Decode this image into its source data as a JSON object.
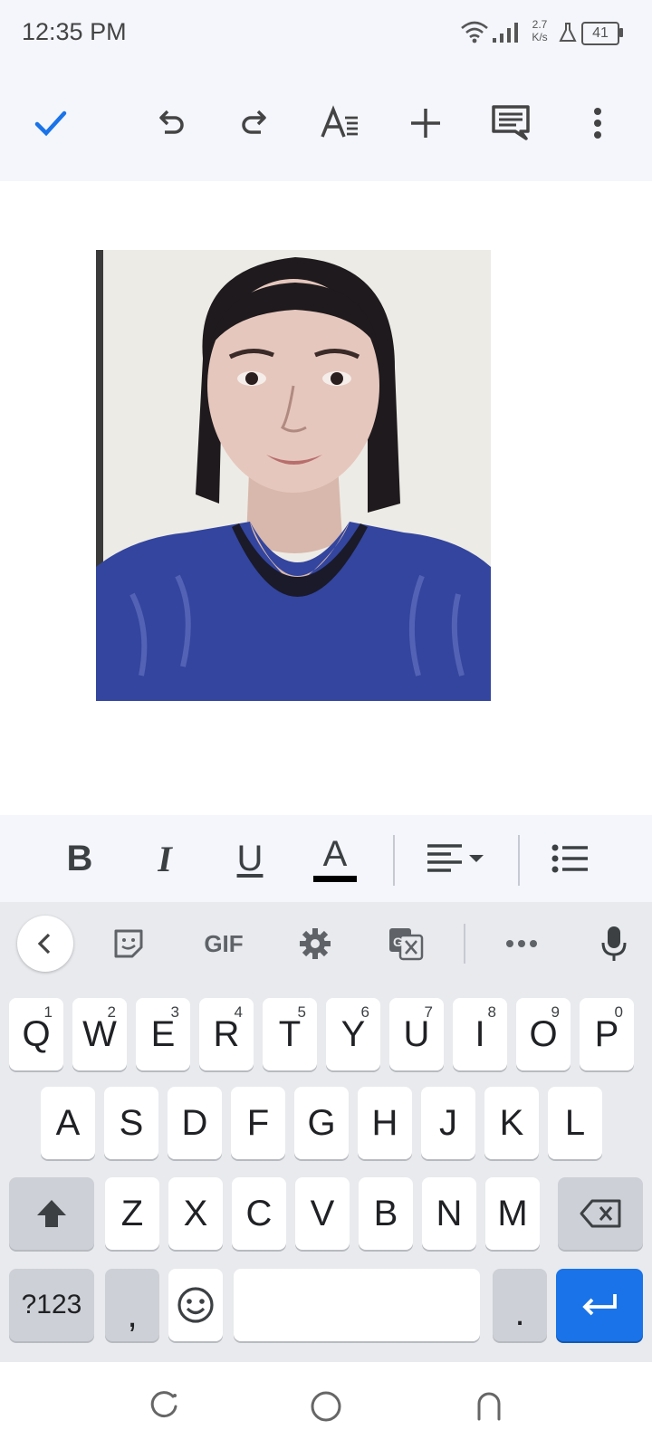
{
  "status_bar": {
    "time": "12:35 PM",
    "speed_value": "2.7",
    "speed_unit": "K/s",
    "battery": "41"
  },
  "toolbar": {
    "icons": [
      "check-icon",
      "undo-icon",
      "redo-icon",
      "text-format-icon",
      "insert-plus-icon",
      "comment-icon",
      "more-vert-icon"
    ]
  },
  "document": {
    "image": "portrait-photo"
  },
  "format_bar": {
    "bold_label": "B",
    "italic_label": "I",
    "underline_label": "U",
    "text_color_label": "A",
    "text_color": "#000000"
  },
  "keyboard": {
    "toolbar_gif_label": "GIF",
    "row1": [
      {
        "key": "Q",
        "hint": "1"
      },
      {
        "key": "W",
        "hint": "2"
      },
      {
        "key": "E",
        "hint": "3"
      },
      {
        "key": "R",
        "hint": "4"
      },
      {
        "key": "T",
        "hint": "5"
      },
      {
        "key": "Y",
        "hint": "6"
      },
      {
        "key": "U",
        "hint": "7"
      },
      {
        "key": "I",
        "hint": "8"
      },
      {
        "key": "O",
        "hint": "9"
      },
      {
        "key": "P",
        "hint": "0"
      }
    ],
    "row2": [
      "A",
      "S",
      "D",
      "F",
      "G",
      "H",
      "J",
      "K",
      "L"
    ],
    "row3": [
      "Z",
      "X",
      "C",
      "V",
      "B",
      "N",
      "M"
    ],
    "symbols_label": "?123",
    "comma_label": ",",
    "period_label": ".",
    "enter_color": "#1a73e8"
  },
  "nav_bar": {
    "icons": [
      "recents-icon",
      "home-icon",
      "back-icon"
    ]
  }
}
